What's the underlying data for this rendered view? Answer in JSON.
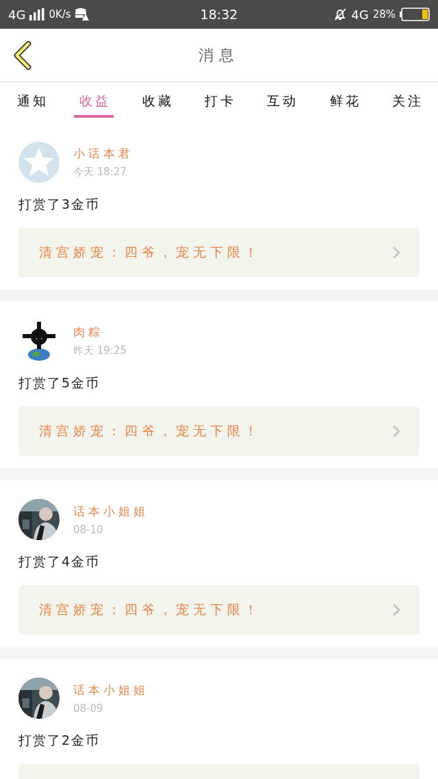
{
  "status_bar": {
    "network": "4G",
    "speed": "0K/s",
    "time": "18:32",
    "network_right": "4G",
    "battery": "28%"
  },
  "header": {
    "title": "消息"
  },
  "tabs": [
    {
      "label": "通知",
      "selected": false
    },
    {
      "label": "收益",
      "selected": true
    },
    {
      "label": "收藏",
      "selected": false
    },
    {
      "label": "打卡",
      "selected": false
    },
    {
      "label": "互动",
      "selected": false
    },
    {
      "label": "鲜花",
      "selected": false
    },
    {
      "label": "关注",
      "selected": false
    }
  ],
  "messages": [
    {
      "avatar": {
        "kind": "default"
      },
      "name": "小话本君",
      "time": "今天 18:27",
      "text": "打赏了3金币",
      "book": "清宫娇宠：四爷，宠无下限！"
    },
    {
      "avatar": {
        "kind": "emblem"
      },
      "name": "肉粽",
      "time": "昨天 19:25",
      "text": "打赏了5金币",
      "book": "清宫娇宠：四爷，宠无下限！"
    },
    {
      "name": "话本小姐姐",
      "time": "08-10",
      "text": "打赏了4金币",
      "book": "清宫娇宠：四爷，宠无下限！"
    },
    {
      "name": "话本小姐姐",
      "time": "08-09",
      "text": "打赏了2金币"
    }
  ]
}
